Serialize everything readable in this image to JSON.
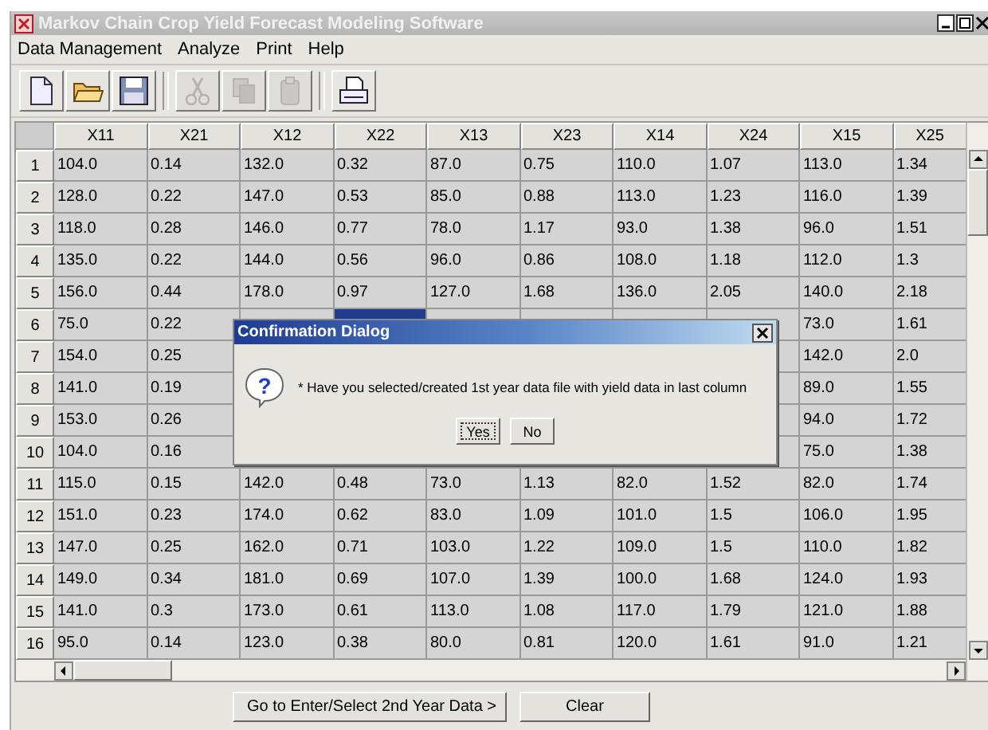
{
  "window": {
    "title": "Markov Chain Crop Yield Forecast Modeling Software"
  },
  "menu": [
    "Data Management",
    "Analyze",
    "Print",
    "Help"
  ],
  "toolbar": [
    {
      "kind": "new",
      "disabled": false
    },
    {
      "kind": "open",
      "disabled": false
    },
    {
      "kind": "save",
      "disabled": false
    },
    {
      "kind": "cut",
      "disabled": true
    },
    {
      "kind": "copy",
      "disabled": true
    },
    {
      "kind": "paste",
      "disabled": true
    },
    {
      "kind": "print",
      "disabled": false
    }
  ],
  "table": {
    "columns": [
      "X11",
      "X21",
      "X12",
      "X22",
      "X13",
      "X23",
      "X14",
      "X24",
      "X15",
      "X25"
    ],
    "rows": [
      {
        "number": "1",
        "cells": [
          "104.0",
          "0.14",
          "132.0",
          "0.32",
          "87.0",
          "0.75",
          "110.0",
          "1.07",
          "113.0",
          "1.34"
        ]
      },
      {
        "number": "2",
        "cells": [
          "128.0",
          "0.22",
          "147.0",
          "0.53",
          "85.0",
          "0.88",
          "113.0",
          "1.23",
          "116.0",
          "1.39"
        ]
      },
      {
        "number": "3",
        "cells": [
          "118.0",
          "0.28",
          "146.0",
          "0.77",
          "78.0",
          "1.17",
          "93.0",
          "1.38",
          "96.0",
          "1.51"
        ]
      },
      {
        "number": "4",
        "cells": [
          "135.0",
          "0.22",
          "144.0",
          "0.56",
          "96.0",
          "0.86",
          "108.0",
          "1.18",
          "112.0",
          "1.3"
        ]
      },
      {
        "number": "5",
        "cells": [
          "156.0",
          "0.44",
          "178.0",
          "0.97",
          "127.0",
          "1.68",
          "136.0",
          "2.05",
          "140.0",
          "2.18"
        ]
      },
      {
        "number": "6",
        "cells": [
          "75.0",
          "0.22",
          {
            "selected": false
          },
          {
            "selected": true
          },
          {
            "selected": false
          },
          {
            "selected": false
          },
          {
            "selected": false
          },
          {
            "selected": false
          },
          "73.0",
          "1.61"
        ]
      },
      {
        "number": "7",
        "cells": [
          "154.0",
          "0.25",
          null,
          null,
          null,
          null,
          null,
          {
            "selected": false
          },
          "142.0",
          "2.0"
        ]
      },
      {
        "number": "8",
        "cells": [
          "141.0",
          "0.19",
          null,
          null,
          null,
          null,
          null,
          {
            "selected": false
          },
          "89.0",
          "1.55"
        ]
      },
      {
        "number": "9",
        "cells": [
          "153.0",
          "0.26",
          null,
          null,
          null,
          null,
          null,
          {
            "selected": false
          },
          "94.0",
          "1.72"
        ]
      },
      {
        "number": "10",
        "cells": [
          "104.0",
          "0.16",
          null,
          null,
          null,
          null,
          null,
          {
            "selected": false
          },
          "75.0",
          "1.38"
        ]
      },
      {
        "number": "11",
        "cells": [
          "115.0",
          "0.15",
          "142.0",
          "0.48",
          "73.0",
          "1.13",
          "82.0",
          "1.52",
          "82.0",
          "1.74"
        ]
      },
      {
        "number": "12",
        "cells": [
          "151.0",
          "0.23",
          "174.0",
          "0.62",
          "83.0",
          "1.09",
          "101.0",
          "1.5",
          "106.0",
          "1.95"
        ]
      },
      {
        "number": "13",
        "cells": [
          "147.0",
          "0.25",
          "162.0",
          "0.71",
          "103.0",
          "1.22",
          "109.0",
          "1.5",
          "110.0",
          "1.82"
        ]
      },
      {
        "number": "14",
        "cells": [
          "149.0",
          "0.34",
          "181.0",
          "0.69",
          "107.0",
          "1.39",
          "100.0",
          "1.68",
          "124.0",
          "1.93"
        ]
      },
      {
        "number": "15",
        "cells": [
          "141.0",
          "0.3",
          "173.0",
          "0.61",
          "113.0",
          "1.08",
          "117.0",
          "1.79",
          "121.0",
          "1.88"
        ]
      },
      {
        "number": "16",
        "cells": [
          "95.0",
          "0.14",
          "123.0",
          "0.38",
          "80.0",
          "0.81",
          "120.0",
          "1.61",
          "91.0",
          "1.21"
        ]
      }
    ]
  },
  "buttons": [
    "Go to Enter/Select 2nd Year Data >",
    "Clear"
  ],
  "dialog": {
    "title": "Confirmation Dialog",
    "icon": "?",
    "message": "* Have you selected/created 1st year data file with yield data in last column",
    "buttons": [
      "Yes",
      "No"
    ]
  }
}
